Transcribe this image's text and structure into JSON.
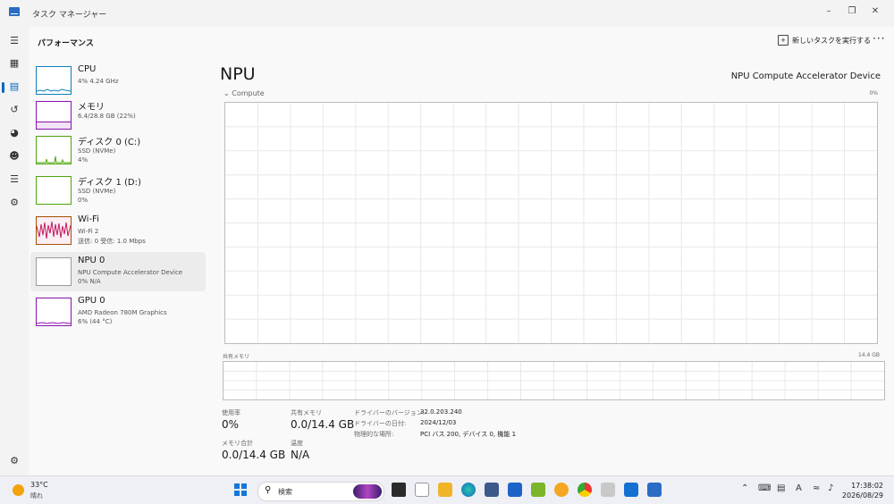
{
  "window": {
    "title": "タスク マネージャー"
  },
  "header": {
    "page_title": "パフォーマンス",
    "run_task_label": "新しいタスクを実行する",
    "more_label": "···"
  },
  "nav": {
    "icons": [
      "hamburger-icon",
      "processes-icon",
      "performance-icon",
      "app-history-icon",
      "startup-icon",
      "users-icon",
      "details-icon",
      "services-icon",
      "settings-icon"
    ]
  },
  "perf_items": [
    {
      "name": "CPU",
      "line1": "4% 4.24 GHz",
      "line2": ""
    },
    {
      "name": "メモリ",
      "line1": "6.4/28.8 GB (22%)",
      "line2": ""
    },
    {
      "name": "ディスク 0 (C:)",
      "line1": "SSD (NVMe)",
      "line2": "4%"
    },
    {
      "name": "ディスク 1 (D:)",
      "line1": "SSD (NVMe)",
      "line2": "0%"
    },
    {
      "name": "Wi-Fi",
      "line1": "Wi-Fi 2",
      "line2": "送信: 0 受信: 1.0 Mbps"
    },
    {
      "name": "NPU 0",
      "line1": "NPU Compute Accelerator Device",
      "line2": "0% N/A"
    },
    {
      "name": "GPU 0",
      "line1": "AMD Radeon 780M Graphics",
      "line2": "6% (44 °C)"
    }
  ],
  "main": {
    "title": "NPU",
    "device": "NPU Compute Accelerator Device",
    "compute_label": "Compute",
    "compute_max": "0%",
    "shared_label": "共有メモリ",
    "shared_max": "14.4 GB",
    "stats": {
      "usage_label": "使用率",
      "usage_value": "0%",
      "shared_label": "共有メモリ",
      "shared_value": "0.0/14.4 GB",
      "total_label": "メモリ合計",
      "total_value": "0.0/14.4 GB",
      "temp_label": "温度",
      "temp_value": "N/A"
    },
    "info": {
      "driver_version_label": "ドライバーのバージョン:",
      "driver_version": "32.0.203.240",
      "driver_date_label": "ドライバーの日付:",
      "driver_date": "2024/12/03",
      "location_label": "物理的な場所:",
      "location": "PCI バス 200, デバイス 0, 機能 1"
    }
  },
  "taskbar": {
    "temperature": "33°C",
    "condition": "晴れ",
    "search_placeholder": "検索",
    "time": "17:38:02",
    "date": "2026/08/29"
  },
  "colors": {
    "accent": "#0067c0",
    "cpu": "#117dbb",
    "memory": "#8b12ae",
    "disk": "#4da60c",
    "wifi": "#a74f01"
  }
}
